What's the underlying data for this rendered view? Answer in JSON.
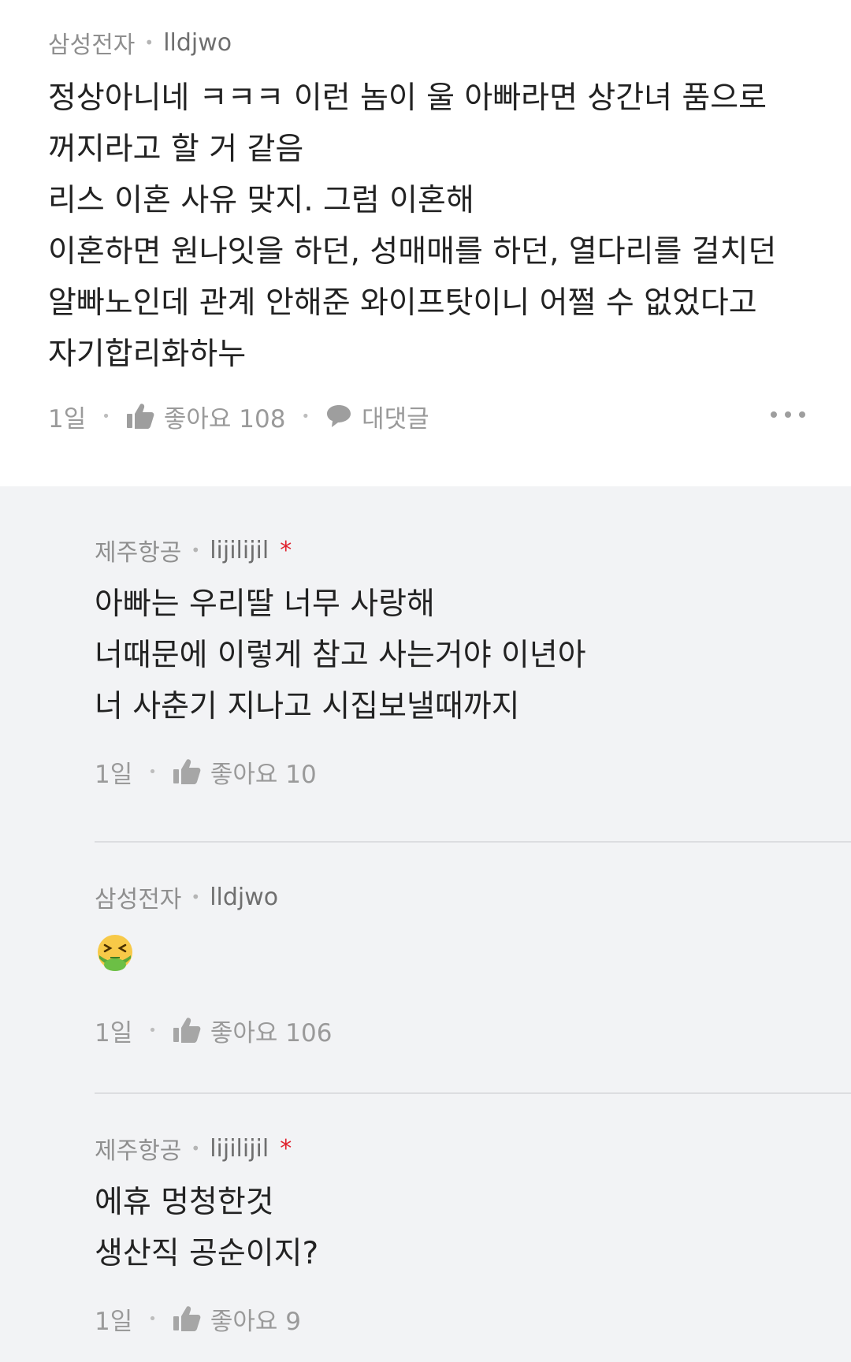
{
  "main_comment": {
    "company": "삼성전자",
    "username": "lldjwo",
    "lines": [
      "정상아니네 ㅋㅋㅋ 이런 놈이 울 아빠라면 상간녀 품으로",
      "꺼지라고 할 거 같음",
      "리스 이혼 사유 맞지. 그럼 이혼해",
      "이혼하면 원나잇을 하던, 성매매를 하던, 열다리를 걸치던",
      "알빠노인데 관계 안해준 와이프탓이니 어쩔 수 없었다고",
      "자기합리화하누"
    ],
    "time": "1일",
    "like_label": "좋아요 108",
    "reply_label": "대댓글"
  },
  "replies": [
    {
      "company": "제주항공",
      "username": "lijilijil",
      "author_star": "*",
      "lines": [
        "아빠는 우리딸 너무 사랑해",
        "너때문에 이렇게 참고 사는거야 이년아",
        "너 사춘기 지나고 시집보낼때까지"
      ],
      "time": "1일",
      "like_label": "좋아요 10"
    },
    {
      "company": "삼성전자",
      "username": "lldjwo",
      "emoji": "nauseated-face-emoji",
      "time": "1일",
      "like_label": "좋아요 106"
    },
    {
      "company": "제주항공",
      "username": "lijilijil",
      "author_star": "*",
      "lines": [
        "에휴 멍청한것",
        "생산직 공순이지?"
      ],
      "time": "1일",
      "like_label": "좋아요 9"
    }
  ],
  "colors": {
    "author_star": "#e0242f",
    "reply_background": "#f2f3f5",
    "meta_text": "#8f8f8f"
  }
}
